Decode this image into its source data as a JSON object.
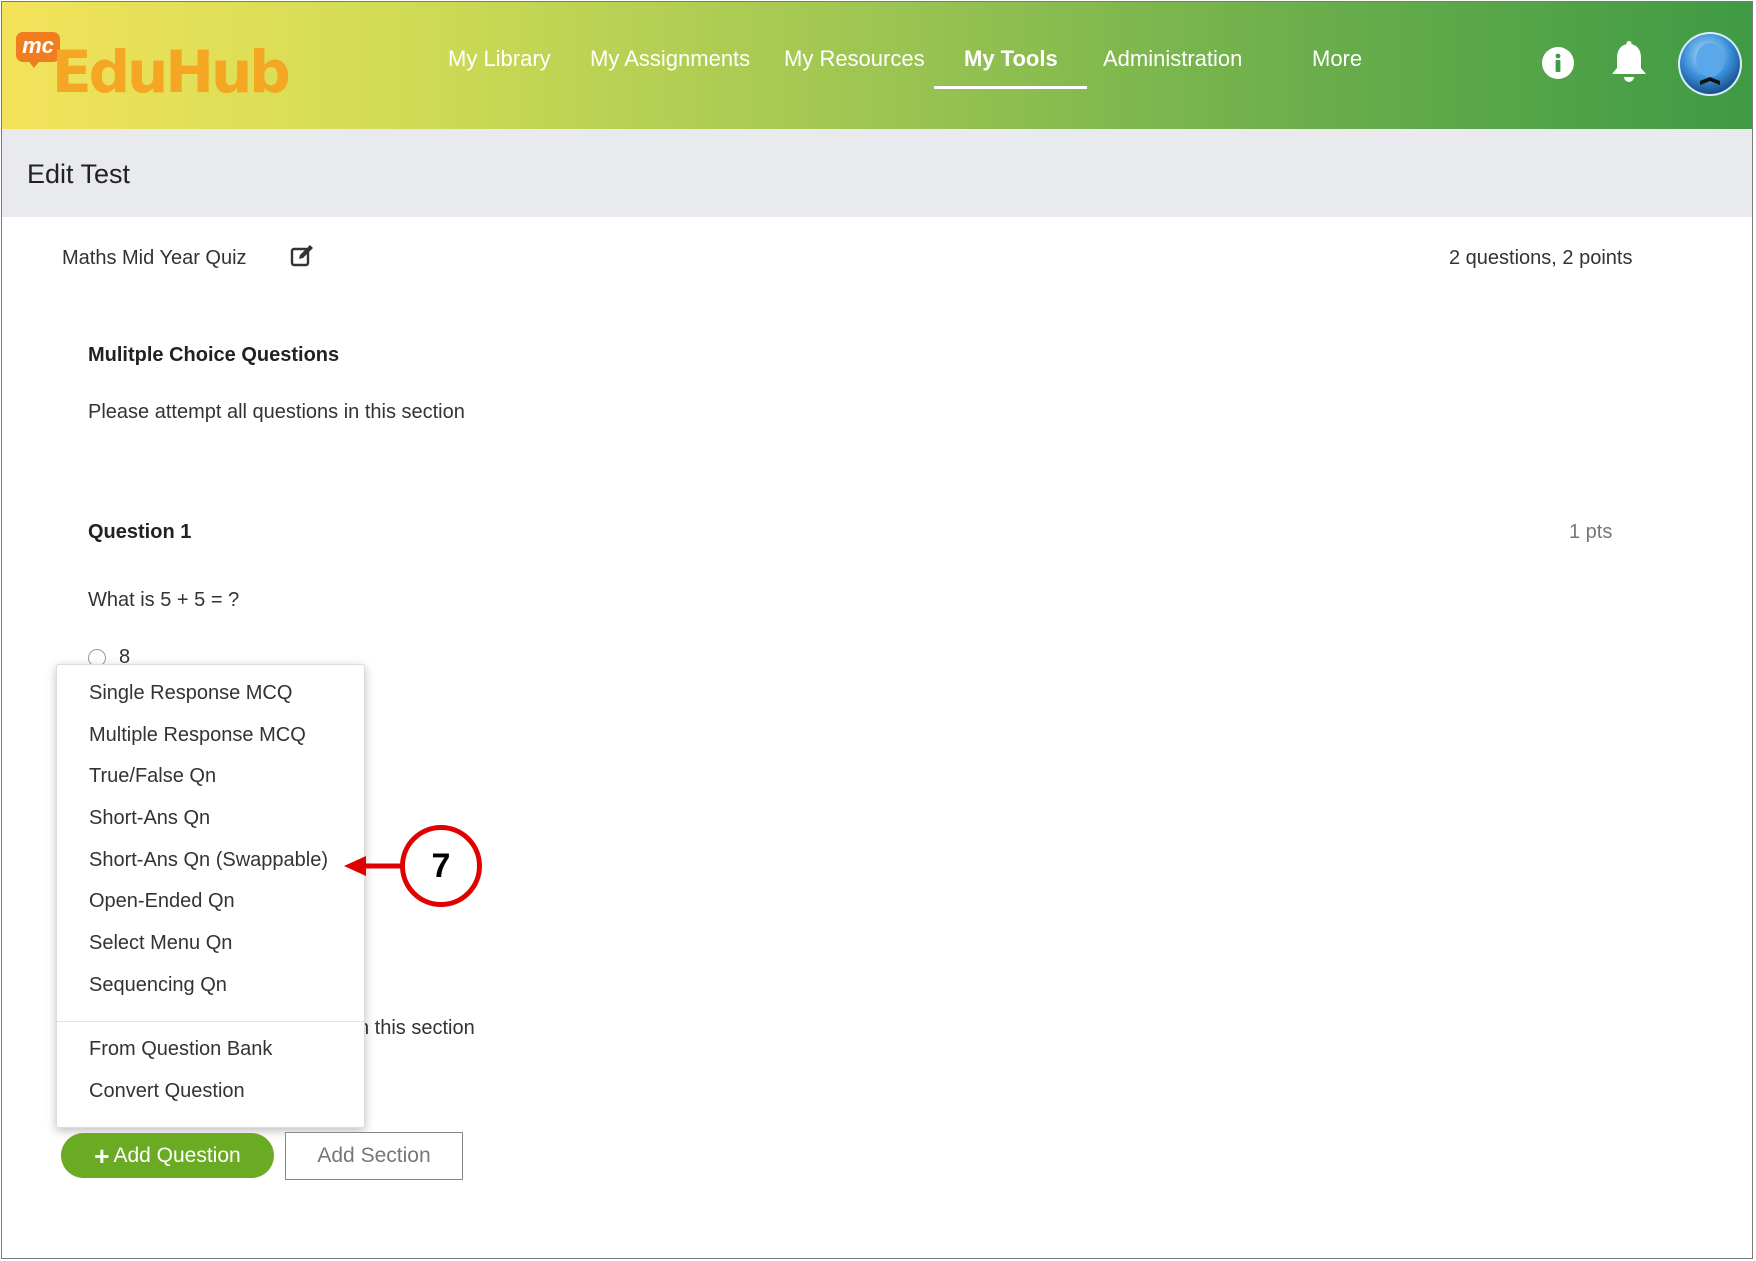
{
  "app": {
    "logo_badge": "mc",
    "logo_text": "EduHub"
  },
  "nav": {
    "items": [
      {
        "label": "My Library"
      },
      {
        "label": "My Assignments"
      },
      {
        "label": "My Resources"
      },
      {
        "label": "My Tools",
        "active": true
      },
      {
        "label": "Administration"
      },
      {
        "label": "More"
      }
    ]
  },
  "header_icons": [
    "info-icon",
    "bell-icon",
    "avatar"
  ],
  "page": {
    "title": "Edit Test"
  },
  "test": {
    "name": "Maths Mid Year Quiz",
    "summary": "2 questions, 2 points"
  },
  "section": {
    "title": "Mulitple Choice Questions",
    "description": "Please attempt all questions in this section"
  },
  "question": {
    "title": "Question 1",
    "points": "1 pts",
    "text": "What is 5 + 5 = ?",
    "options": [
      "8"
    ]
  },
  "section2": {
    "description_visible": "n this section"
  },
  "add_question_menu": {
    "items": [
      "Single Response MCQ",
      "Multiple Response MCQ",
      "True/False Qn",
      "Short-Ans Qn",
      "Short-Ans Qn (Swappable)",
      "Open-Ended Qn",
      "Select Menu Qn",
      "Sequencing Qn"
    ],
    "extra_items": [
      "From Question Bank",
      "Convert Question"
    ]
  },
  "buttons": {
    "add_question_plus": "+",
    "add_question": "Add Question",
    "add_section": "Add Section"
  },
  "callout": {
    "number": "7",
    "color": "#e00000"
  },
  "colors": {
    "accent_green": "#6bab23",
    "header_gradient_start": "#f3e35a",
    "header_gradient_end": "#3f9a45"
  }
}
